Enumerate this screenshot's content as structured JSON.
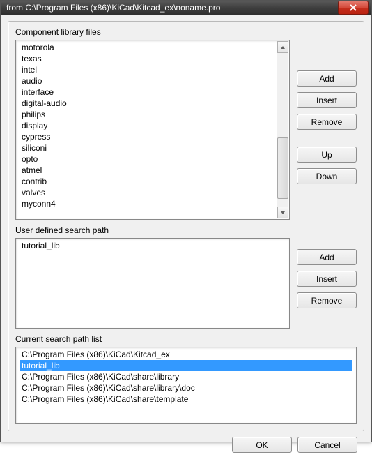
{
  "window": {
    "title": "from C:\\Program Files (x86)\\KiCad\\Kitcad_ex\\noname.pro"
  },
  "section1": {
    "label": "Component library files",
    "items": [
      "motorola",
      "texas",
      "intel",
      "audio",
      "interface",
      "digital-audio",
      "philips",
      "display",
      "cypress",
      "siliconi",
      "opto",
      "atmel",
      "contrib",
      "valves",
      "myconn4"
    ],
    "buttons": {
      "add": "Add",
      "insert": "Insert",
      "remove": "Remove",
      "up": "Up",
      "down": "Down"
    }
  },
  "section2": {
    "label": "User defined search path",
    "items": [
      "tutorial_lib"
    ],
    "buttons": {
      "add": "Add",
      "insert": "Insert",
      "remove": "Remove"
    }
  },
  "section3": {
    "label": "Current search path list",
    "items": [
      "C:\\Program Files (x86)\\KiCad\\Kitcad_ex",
      "tutorial_lib",
      "C:\\Program Files (x86)\\KiCad\\share\\library",
      "C:\\Program Files (x86)\\KiCad\\share\\library\\doc",
      "C:\\Program Files (x86)\\KiCad\\share\\template"
    ],
    "selected_index": 1
  },
  "footer": {
    "ok": "OK",
    "cancel": "Cancel"
  }
}
